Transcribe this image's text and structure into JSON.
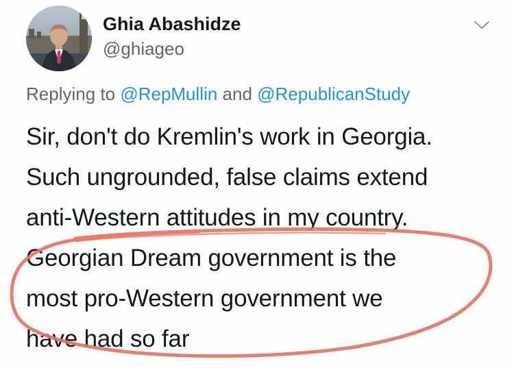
{
  "user": {
    "display_name": "Ghia Abashidze",
    "handle": "@ghiageo"
  },
  "reply": {
    "prefix": "Replying to ",
    "mention_1": "@RepMullin",
    "joiner": " and ",
    "mention_2": "@RepublicanStudy"
  },
  "tweet": {
    "lines": [
      "Sir, don't do Kremlin's work in Georgia.",
      "Such ungrounded, false claims extend",
      "anti-Western attitudes in my country.",
      "Georgian Dream government is the",
      "most pro-Western government we",
      "have had so far"
    ]
  },
  "icons": {
    "avatar": "profile-photo",
    "menu": "chevron-down-icon"
  },
  "colors": {
    "text": "#14171a",
    "secondary": "#5b6670",
    "link": "#1b95e0",
    "annotation": "#e8735f"
  }
}
